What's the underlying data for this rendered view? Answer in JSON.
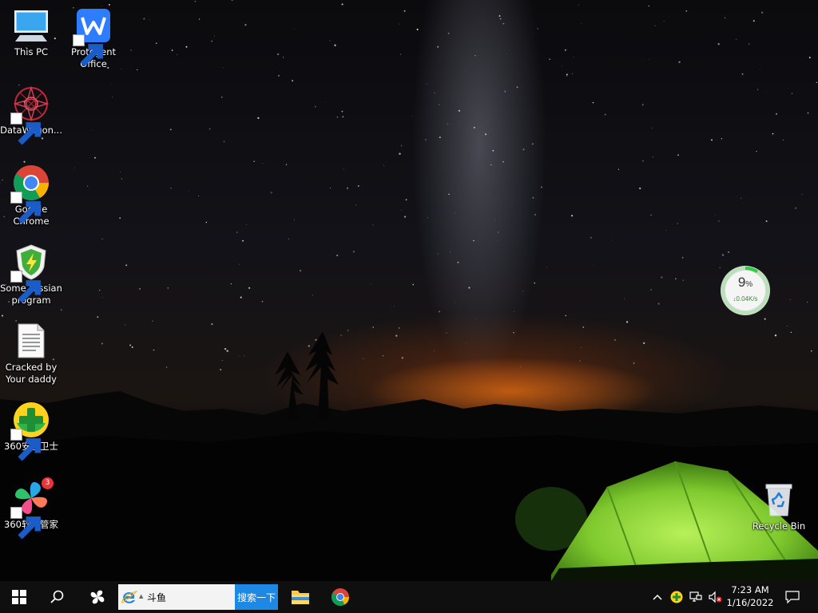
{
  "desktop_icons": [
    {
      "label": "This PC",
      "icon": "computer-icon",
      "shortcut": false
    },
    {
      "label": "Protegent Office",
      "icon": "office-icon",
      "shortcut": true
    },
    {
      "label": "DataWagon...",
      "icon": "datawagon-icon",
      "shortcut": true
    },
    {
      "label": "Google Chrome",
      "icon": "chrome-icon",
      "shortcut": true
    },
    {
      "label": "Some russian program",
      "icon": "shield-bolt-icon",
      "shortcut": true
    },
    {
      "label": "Cracked by Your daddy",
      "icon": "text-document-icon",
      "shortcut": false
    },
    {
      "label": "360安全卫士",
      "icon": "360-security-icon",
      "shortcut": true
    },
    {
      "label": "360软件管家",
      "icon": "360-software-manager-icon",
      "shortcut": true,
      "badge": "3"
    },
    {
      "label": "Recycle Bin",
      "icon": "recycle-bin-icon",
      "shortcut": false
    }
  ],
  "net_widget": {
    "percent": "9",
    "percent_symbol": "%",
    "speed": "↓0.04K/s",
    "level": 0.09
  },
  "taskbar": {
    "search": {
      "value": "斗鱼",
      "button_label": "搜索一下"
    },
    "clock": {
      "time": "7:23 AM",
      "date": "1/16/2022"
    }
  },
  "colors": {
    "taskbar": "#101010",
    "search_button": "#1e88e5",
    "chrome_red": "#db4437",
    "chrome_yellow": "#f4b400",
    "chrome_green": "#0f9d58",
    "chrome_blue": "#4285f4",
    "tent_green": "#8bd33a"
  }
}
